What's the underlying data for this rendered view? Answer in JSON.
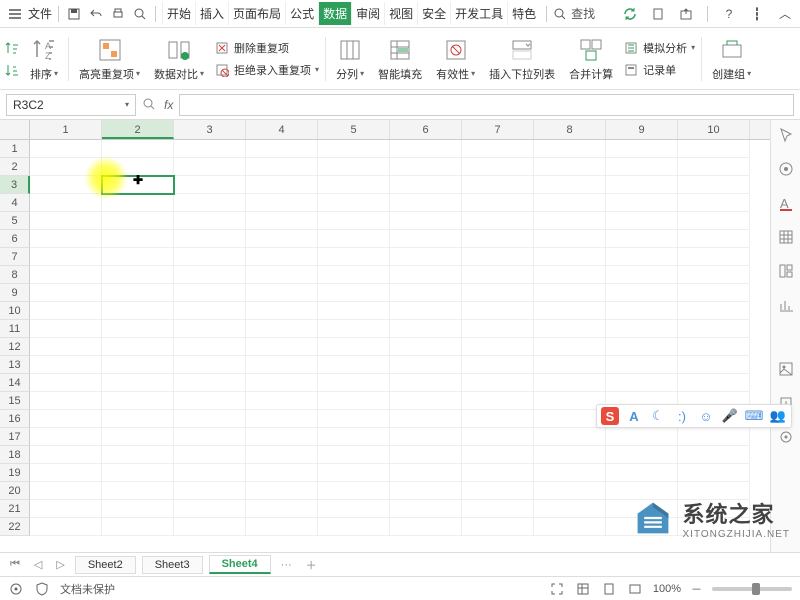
{
  "menu": {
    "file": "文件"
  },
  "tabs": [
    "开始",
    "插入",
    "页面布局",
    "公式",
    "数据",
    "审阅",
    "视图",
    "安全",
    "开发工具",
    "特色"
  ],
  "active_tab_index": 4,
  "search_label": "查找",
  "ribbon": {
    "sort": "排序",
    "highlight_dup": "高亮重复项",
    "data_compare": "数据对比",
    "delete_dup": "删除重复项",
    "reject_dup": "拒绝录入重复项",
    "text_to_columns": "分列",
    "smart_fill": "智能填充",
    "validation": "有效性",
    "dropdown_list": "插入下拉列表",
    "consolidate": "合并计算",
    "simulation": "模拟分析",
    "record_form": "记录单",
    "create_group": "创建组"
  },
  "name_box": "R3C2",
  "fx_label": "fx",
  "columns": [
    "1",
    "2",
    "3",
    "4",
    "5",
    "6",
    "7",
    "8",
    "9",
    "10"
  ],
  "rows": [
    "1",
    "2",
    "3",
    "4",
    "5",
    "6",
    "7",
    "8",
    "9",
    "10",
    "11",
    "12",
    "13",
    "14",
    "15",
    "16",
    "17",
    "18",
    "19",
    "20",
    "21",
    "22"
  ],
  "selected": {
    "row": 3,
    "col": 2
  },
  "sheet_tabs": [
    "Sheet2",
    "Sheet3",
    "Sheet4"
  ],
  "active_sheet_index": 2,
  "more_sheets": "···",
  "status": {
    "protect": "文档未保护",
    "zoom": "100%"
  },
  "watermark": {
    "cn": "系统之家",
    "en": "XITONGZHIJIA.NET"
  },
  "floating_items": [
    "S",
    "A",
    "☾",
    ":)",
    "☺",
    "🎤",
    "⌨",
    "👥"
  ],
  "colors": {
    "accent": "#2e9e5b",
    "s_badge": "#e74c3c"
  }
}
